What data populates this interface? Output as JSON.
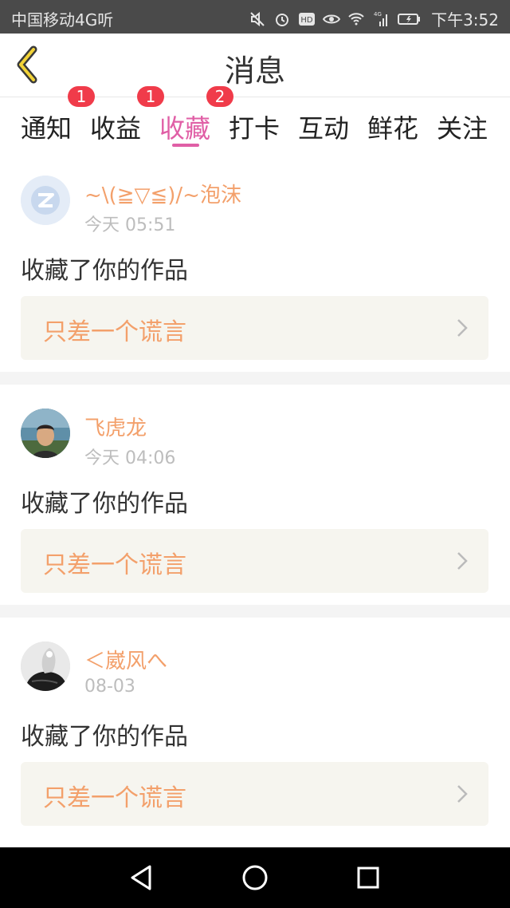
{
  "status_bar": {
    "carrier": "中国移动4G听",
    "network": "4G",
    "time": "下午3:52",
    "icons": [
      "mute-icon",
      "alarm-icon",
      "hd-icon",
      "eye-icon",
      "wifi-icon",
      "signal-icon",
      "battery-icon"
    ]
  },
  "header": {
    "title": "消息"
  },
  "tabs": [
    {
      "label": "通知",
      "badge": ""
    },
    {
      "label": "收益",
      "badge": "1"
    },
    {
      "label": "收藏",
      "badge": "1"
    },
    {
      "label": "打卡",
      "badge": "2"
    },
    {
      "label": "互动",
      "badge": ""
    },
    {
      "label": "鲜花",
      "badge": ""
    },
    {
      "label": "关注",
      "badge": ""
    }
  ],
  "active_tab": "收藏",
  "messages": [
    {
      "user": "~\\(≧▽≦)/~泡沫",
      "time": "今天 05:51",
      "action": "收藏了你的作品",
      "work": "只差一个谎言"
    },
    {
      "user": "飞虎龙",
      "time": "今天 04:06",
      "action": "收藏了你的作品",
      "work": "只差一个谎言"
    },
    {
      "user": "＜崴风へ",
      "time": "08-03",
      "action": "收藏了你的作品",
      "work": "只差一个谎言"
    }
  ],
  "colors": {
    "accent": "#e05fa6",
    "name": "#f3a06b",
    "badge": "#f03b4a",
    "status_bar": "#4a4a4a"
  }
}
